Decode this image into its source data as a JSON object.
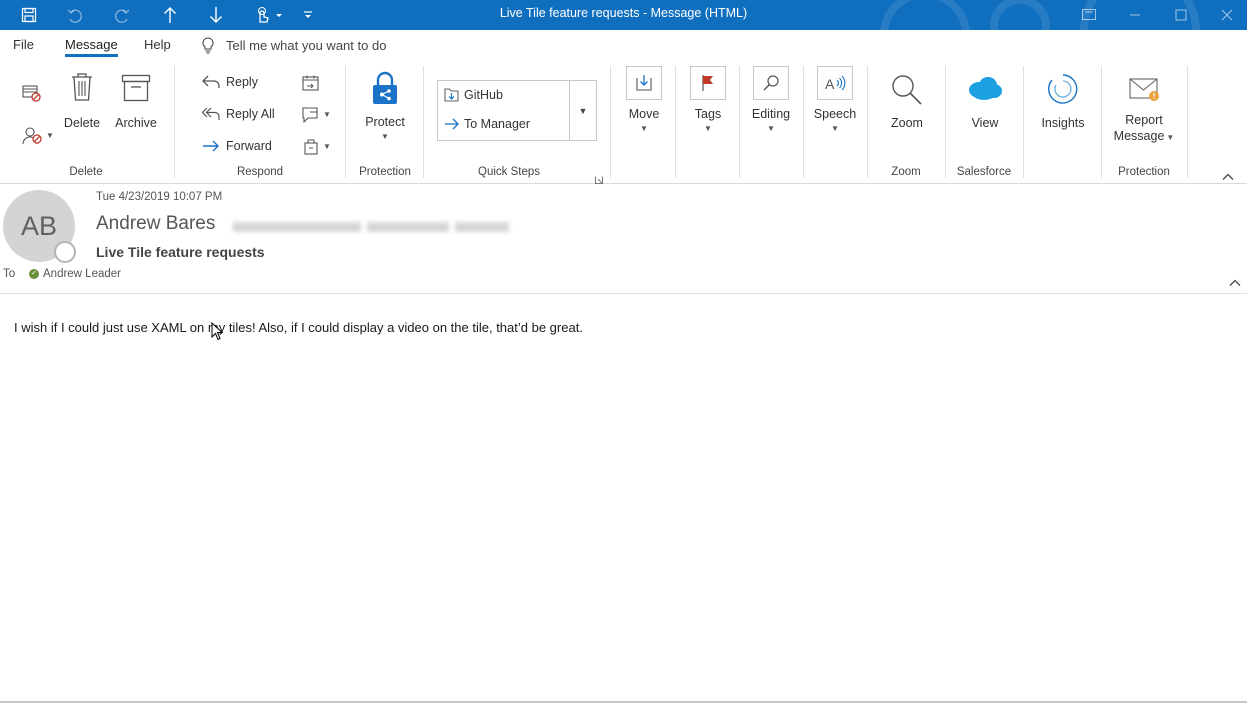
{
  "window": {
    "title": "Live Tile feature requests  -  Message (HTML)",
    "accent": "#106ebe"
  },
  "tabs": [
    {
      "label": "File"
    },
    {
      "label": "Message"
    },
    {
      "label": "Help"
    }
  ],
  "tell_me": "Tell me what you want to do",
  "ribbon": {
    "delete_group": {
      "label": "Delete",
      "delete": "Delete",
      "archive": "Archive"
    },
    "respond_group": {
      "label": "Respond",
      "reply": "Reply",
      "reply_all": "Reply All",
      "forward": "Forward"
    },
    "protection_group": {
      "label": "Protection",
      "protect": "Protect"
    },
    "quick_steps_group": {
      "label": "Quick Steps",
      "items": [
        "GitHub",
        "To Manager"
      ]
    },
    "move": "Move",
    "tags": "Tags",
    "editing": "Editing",
    "speech": "Speech",
    "zoom_group": {
      "label": "Zoom",
      "zoom": "Zoom"
    },
    "salesforce_group": {
      "label": "Salesforce",
      "view": "View"
    },
    "insights": "Insights",
    "protection2_group": {
      "label": "Protection",
      "report_line1": "Report",
      "report_line2": "Message"
    }
  },
  "message": {
    "date": "Tue 4/23/2019 10:07 PM",
    "avatar_initials": "AB",
    "sender": "Andrew Bares",
    "subject": "Live Tile feature requests",
    "to_label": "To",
    "recipient": "Andrew Leader",
    "body": "I wish if I could just use XAML on my tiles! Also, if I could display a video on the tile, that’d be great."
  }
}
